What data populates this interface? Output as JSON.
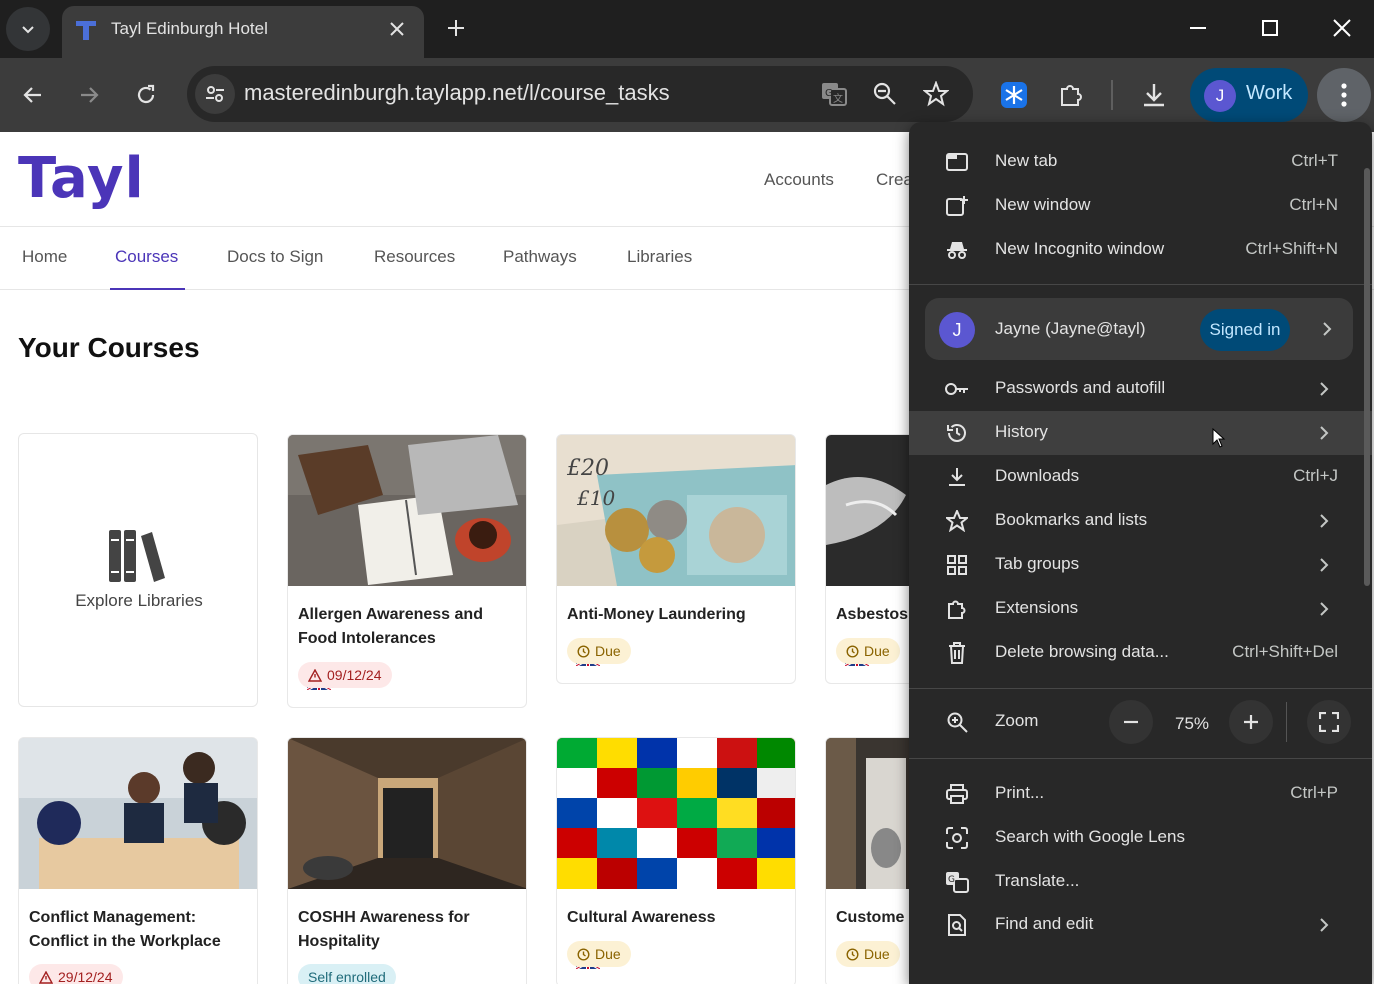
{
  "browser": {
    "tab_title": "Tayl Edinburgh Hotel",
    "url": "masteredinburgh.taylapp.net/l/course_tasks",
    "profile_label": "Work",
    "profile_initial": "J"
  },
  "site": {
    "logo": "Tayl",
    "header_links": [
      "Accounts",
      "Crea"
    ],
    "subnav": [
      "Home",
      "Courses",
      "Docs to Sign",
      "Resources",
      "Pathways",
      "Libraries"
    ],
    "active_subnav": "Courses",
    "page_title": "Your Courses",
    "explore_label": "Explore Libraries"
  },
  "courses": [
    {
      "title": "Allergen Awareness and Food Intolerances",
      "status": "09/12/24",
      "status_type": "overdue"
    },
    {
      "title": "Anti-Money Laundering",
      "status": "Due",
      "status_type": "due"
    },
    {
      "title": "Asbestos",
      "status": "Due",
      "status_type": "due"
    },
    {
      "title": "Conflict Management: Conflict in the Workplace",
      "status": "29/12/24",
      "status_type": "overdue"
    },
    {
      "title": "COSHH Awareness for Hospitality",
      "status": "Self enrolled",
      "status_type": "enrolled"
    },
    {
      "title": "Cultural Awareness",
      "status": "Due",
      "status_type": "due"
    },
    {
      "title": "Custome",
      "status": "Due",
      "status_type": "due"
    }
  ],
  "menu": {
    "new_tab": "New tab",
    "new_tab_sc": "Ctrl+T",
    "new_window": "New window",
    "new_window_sc": "Ctrl+N",
    "incognito": "New Incognito window",
    "incognito_sc": "Ctrl+Shift+N",
    "account_initial": "J",
    "account_name": "Jayne (Jayne@tayl)",
    "signed_in": "Signed in",
    "passwords": "Passwords and autofill",
    "history": "History",
    "downloads": "Downloads",
    "downloads_sc": "Ctrl+J",
    "bookmarks": "Bookmarks and lists",
    "tab_groups": "Tab groups",
    "extensions": "Extensions",
    "delete_data": "Delete browsing data...",
    "delete_data_sc": "Ctrl+Shift+Del",
    "zoom": "Zoom",
    "zoom_value": "75%",
    "print": "Print...",
    "print_sc": "Ctrl+P",
    "lens": "Search with Google Lens",
    "translate": "Translate...",
    "find": "Find and edit"
  },
  "colors": {
    "brand": "#4b35b8",
    "chrome_dark": "#282828",
    "profile_chip": "#004a77"
  }
}
